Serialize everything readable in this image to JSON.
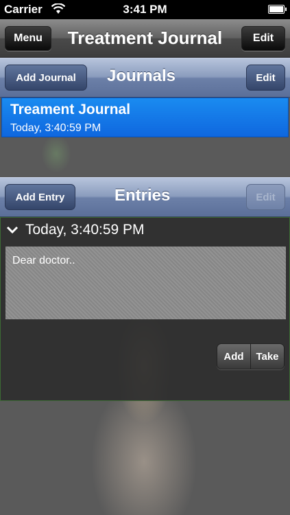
{
  "status_bar": {
    "carrier": "Carrier",
    "time": "3:41 PM"
  },
  "nav": {
    "menu_label": "Menu",
    "title": "Treatment Journal",
    "edit_label": "Edit"
  },
  "journals": {
    "add_label": "Add Journal",
    "title": "Journals",
    "edit_label": "Edit",
    "items": [
      {
        "title": "Treament Journal",
        "subtitle": "Today, 3:40:59 PM"
      }
    ]
  },
  "entries": {
    "add_label": "Add Entry",
    "title": "Entries",
    "edit_label": "Edit",
    "items": [
      {
        "date": "Today, 3:40:59 PM",
        "text": "Dear doctor..",
        "photo_add": "Add",
        "photo_take": "Take"
      }
    ]
  },
  "colors": {
    "accent": "#1480ea",
    "section": "#7386ad",
    "background": "#5a5a5a"
  }
}
